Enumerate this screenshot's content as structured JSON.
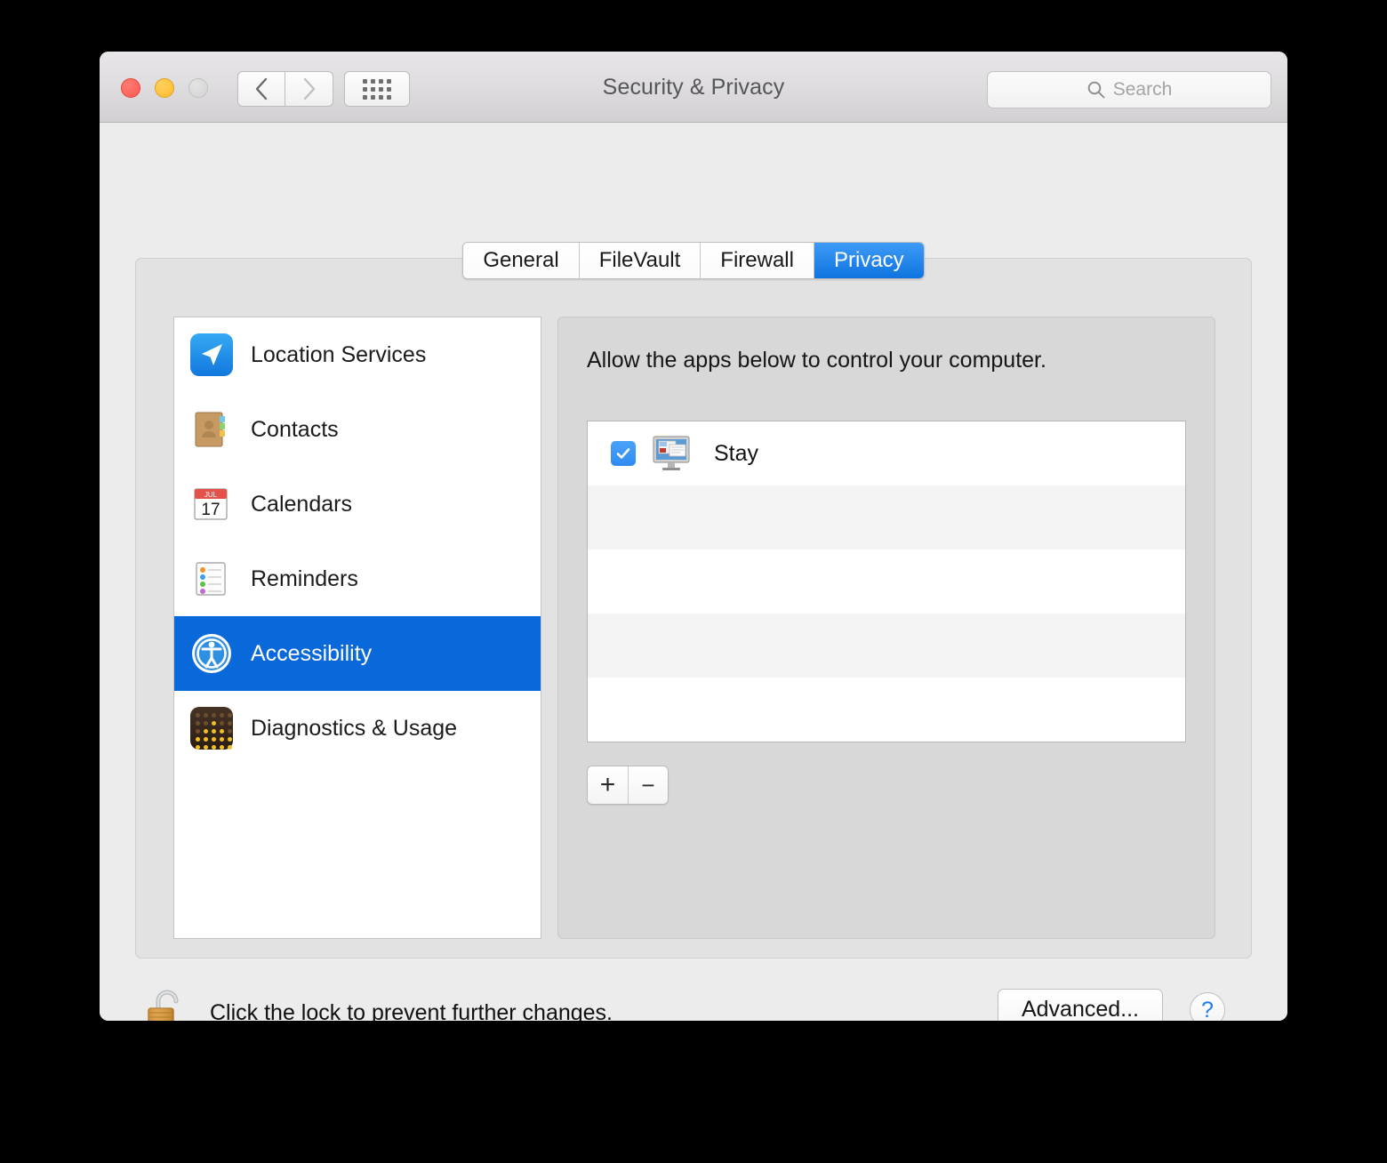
{
  "window": {
    "title": "Security & Privacy",
    "traffic_lights": [
      "close-button",
      "minimize-button",
      "zoom-button"
    ],
    "nav": {
      "back": "back-icon",
      "forward": "forward-icon",
      "show_all": "grid-icon"
    },
    "search": {
      "placeholder": "Search",
      "icon": "search-icon"
    }
  },
  "tabs": [
    {
      "label": "General",
      "active": false
    },
    {
      "label": "FileVault",
      "active": false
    },
    {
      "label": "Firewall",
      "active": false
    },
    {
      "label": "Privacy",
      "active": true
    }
  ],
  "sidebar": {
    "items": [
      {
        "label": "Location Services",
        "icon": "location-services-icon",
        "selected": false
      },
      {
        "label": "Contacts",
        "icon": "contacts-icon",
        "selected": false
      },
      {
        "label": "Calendars",
        "icon": "calendars-icon",
        "selected": false
      },
      {
        "label": "Reminders",
        "icon": "reminders-icon",
        "selected": false
      },
      {
        "label": "Accessibility",
        "icon": "accessibility-icon",
        "selected": true
      },
      {
        "label": "Diagnostics & Usage",
        "icon": "diagnostics-usage-icon",
        "selected": false
      }
    ]
  },
  "calendar_icon": {
    "month": "JUL",
    "day": "17"
  },
  "content": {
    "heading": "Allow the apps below to control your computer.",
    "apps": [
      {
        "name": "Stay",
        "checked": true,
        "icon": "stay-app-icon"
      }
    ],
    "add_label": "+",
    "remove_label": "−"
  },
  "footer": {
    "lock_icon": "unlocked-padlock-icon",
    "lock_text": "Click the lock to prevent further changes.",
    "advanced_label": "Advanced...",
    "help_label": "?"
  },
  "colors": {
    "accent_blue": "#0a69da",
    "tab_active_blue": "#1f84ea",
    "checkbox_blue": "#3b99f5",
    "help_blue": "#1d7df4",
    "window_bg": "#ececec",
    "panel_bg": "#e2e2e2",
    "content_bg": "#d8d8d8"
  }
}
